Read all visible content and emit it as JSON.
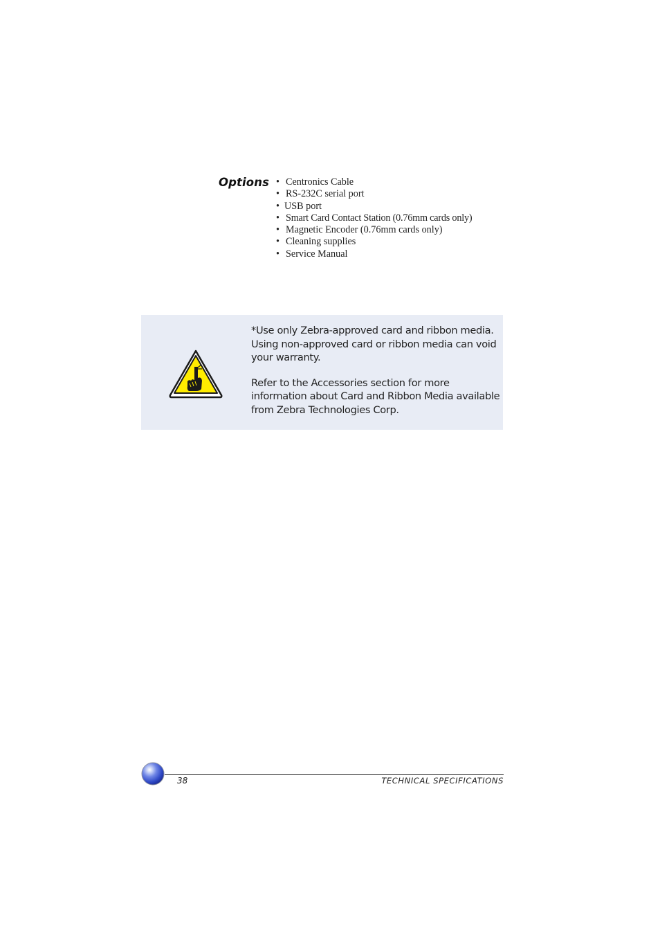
{
  "options": {
    "heading": "Options",
    "bullet": "•",
    "items": [
      "Centronics  Cable",
      "RS-232C serial port",
      "USB port",
      "Smart  Card  Contact  Station  (0.76mm  cards  only)",
      "Magnetic  Encoder  (0.76mm  cards  only)",
      "Cleaning  supplies",
      "Service  Manual"
    ]
  },
  "note": {
    "icon": "caution-hand-icon",
    "paragraphs": [
      "*Use only Zebra-approved card and ribbon media. Using non-approved card or ribbon media can void your warranty.",
      "Refer to the Accessories section for more information about Card and Ribbon Media available from Zebra Technologies Corp."
    ],
    "colors": {
      "background": "#e8ecf5",
      "icon_fill": "#ffec00"
    }
  },
  "footer": {
    "page_number": "38",
    "section_title": "TECHNICAL  SPECIFICATIONS",
    "icon": "blue-sphere-icon"
  }
}
